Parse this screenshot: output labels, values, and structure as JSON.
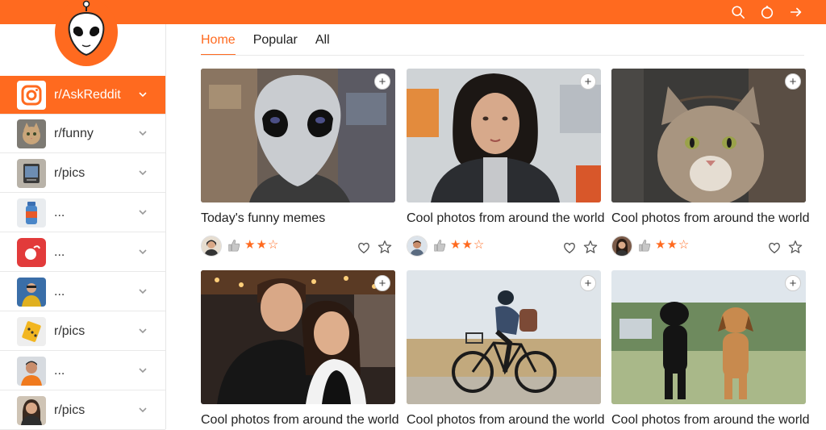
{
  "app": {
    "brand_color": "#ff6a1f"
  },
  "header": {
    "icons": [
      "search-icon",
      "notifications-icon",
      "login-arrow-icon"
    ]
  },
  "sidebar": {
    "items": [
      {
        "label": "r/AskReddit",
        "icon": "instagram-camera-icon",
        "active": true
      },
      {
        "label": "r/funny",
        "icon": "cat-thumbnail"
      },
      {
        "label": "r/pics",
        "icon": "device-thumbnail"
      },
      {
        "label": "...",
        "icon": "bottle-thumbnail"
      },
      {
        "label": "...",
        "icon": "red-app-thumbnail"
      },
      {
        "label": "...",
        "icon": "person-blue-thumbnail"
      },
      {
        "label": "r/pics",
        "icon": "yellow-tile-thumbnail"
      },
      {
        "label": "...",
        "icon": "man-orange-thumbnail"
      },
      {
        "label": "r/pics",
        "icon": "woman-thumbnail"
      }
    ]
  },
  "tabs": [
    {
      "label": "Home",
      "active": true
    },
    {
      "label": "Popular"
    },
    {
      "label": "All"
    }
  ],
  "cards": [
    {
      "title": "Today's funny memes",
      "rating": 3,
      "image": "alien-photo"
    },
    {
      "title": "Cool photos from around the world",
      "rating": 3,
      "image": "woman-photo"
    },
    {
      "title": "Cool photos from around the world",
      "rating": 3,
      "image": "cat-photo"
    },
    {
      "title": "Cool photos from around the world",
      "image": "couple-photo"
    },
    {
      "title": "Cool photos from around the world",
      "image": "cyclist-photo"
    },
    {
      "title": "Cool photos from around the world",
      "image": "dogs-photo"
    }
  ]
}
